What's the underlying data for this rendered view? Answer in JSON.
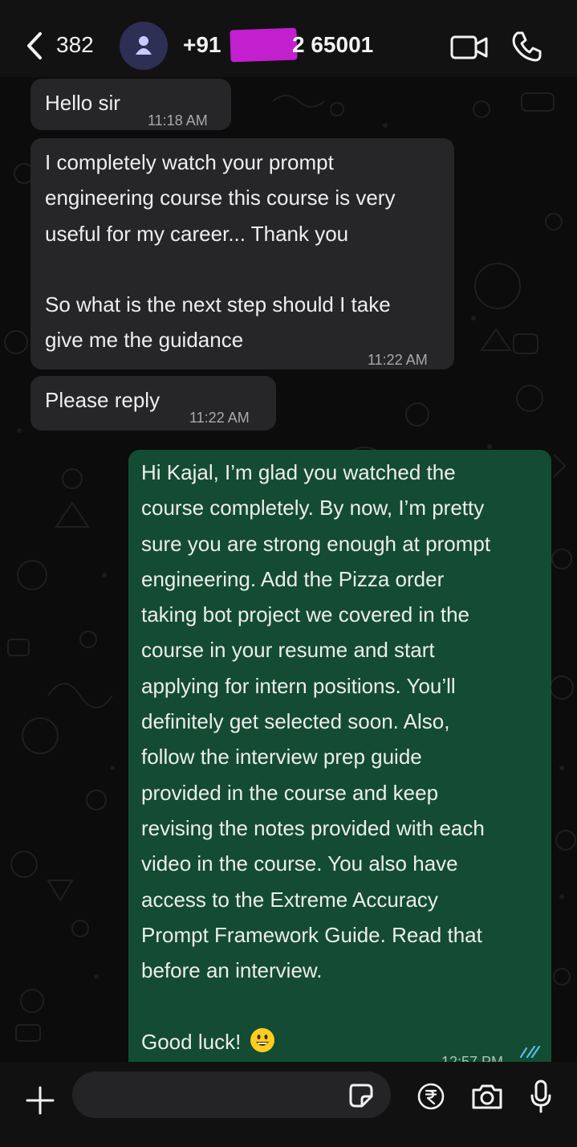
{
  "header": {
    "back_count": "382",
    "phone_prefix": "+91",
    "phone_suffix": "​2 65001",
    "icons": [
      "chevron-left-icon",
      "person-icon",
      "video-call-icon",
      "phone-icon"
    ]
  },
  "messages": [
    {
      "direction": "incoming",
      "text": "Hello sir",
      "time": "11:18 AM"
    },
    {
      "direction": "incoming",
      "text": "I completely watch your prompt\nengineering course this course is very\nuseful for my career... Thank you\n\nSo what is the next step should I take\ngive me the guidance",
      "time": "11:22 AM"
    },
    {
      "direction": "incoming",
      "text": "Please reply",
      "time": "11:22 AM"
    },
    {
      "direction": "outgoing",
      "text": "Hi Kajal, I’m glad you watched the\ncourse completely. By now, I’m pretty\nsure you are strong enough at prompt\nengineering. Add the Pizza order\ntaking bot project we covered in the\ncourse in your resume and start\napplying for intern positions. You’ll\ndefinitely get selected soon. Also,\nfollow the interview prep guide\nprovided in the course and keep\nrevising the notes provided with each\nvideo in the course. You also have\naccess to the Extreme Accuracy\nPrompt Framework Guide. Read that\nbefore an interview.\n\nGood luck!",
      "emoji": "grinning-face-icon",
      "time": "12:57 PM",
      "status": "read"
    }
  ],
  "composer": {
    "placeholder": "",
    "icons": [
      "plus-icon",
      "sticker-icon",
      "rupee-payment-icon",
      "camera-icon",
      "microphone-icon"
    ]
  },
  "colors": {
    "background": "#0b0b0c",
    "incoming_bubble": "#262628",
    "outgoing_bubble": "#134c32",
    "avatar": "#2d2f55",
    "redaction": "#c21fcf",
    "read_ticks": "#53bdeb"
  }
}
